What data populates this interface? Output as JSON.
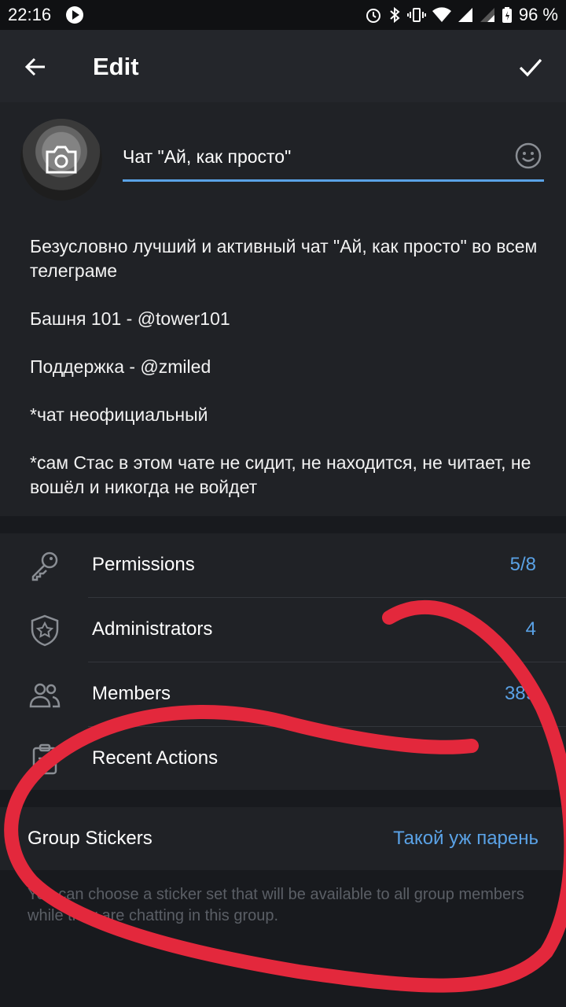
{
  "status_bar": {
    "time": "22:16",
    "battery": "96 %"
  },
  "header": {
    "title": "Edit",
    "back_icon": "arrow-left-icon",
    "done_icon": "checkmark-icon"
  },
  "group": {
    "name": "Чат \"Ай, как просто\"",
    "description": [
      "Безусловно лучший и активный чат \"Ай, как просто\" во всем телеграме",
      "Башня 101 - @tower101",
      "Поддержка - @zmiled",
      "*чат неофициальный",
      "*сам Стас в этом чате не сидит, не находится, не читает, не вошёл и никогда не войдет"
    ]
  },
  "settings": {
    "items": [
      {
        "label": "Permissions",
        "value": "5/8",
        "icon": "key-icon"
      },
      {
        "label": "Administrators",
        "value": "4",
        "icon": "shield-star-icon"
      },
      {
        "label": "Members",
        "value": "389",
        "icon": "people-icon"
      },
      {
        "label": "Recent Actions",
        "value": "",
        "icon": "clipboard-icon"
      }
    ]
  },
  "stickers": {
    "label": "Group Stickers",
    "value": "Такой уж парень",
    "hint": "You can choose a sticker set that will be available to all group members while they are chatting in this group."
  },
  "colors": {
    "accent": "#5aa2e6",
    "annotation": "#e3283c"
  }
}
